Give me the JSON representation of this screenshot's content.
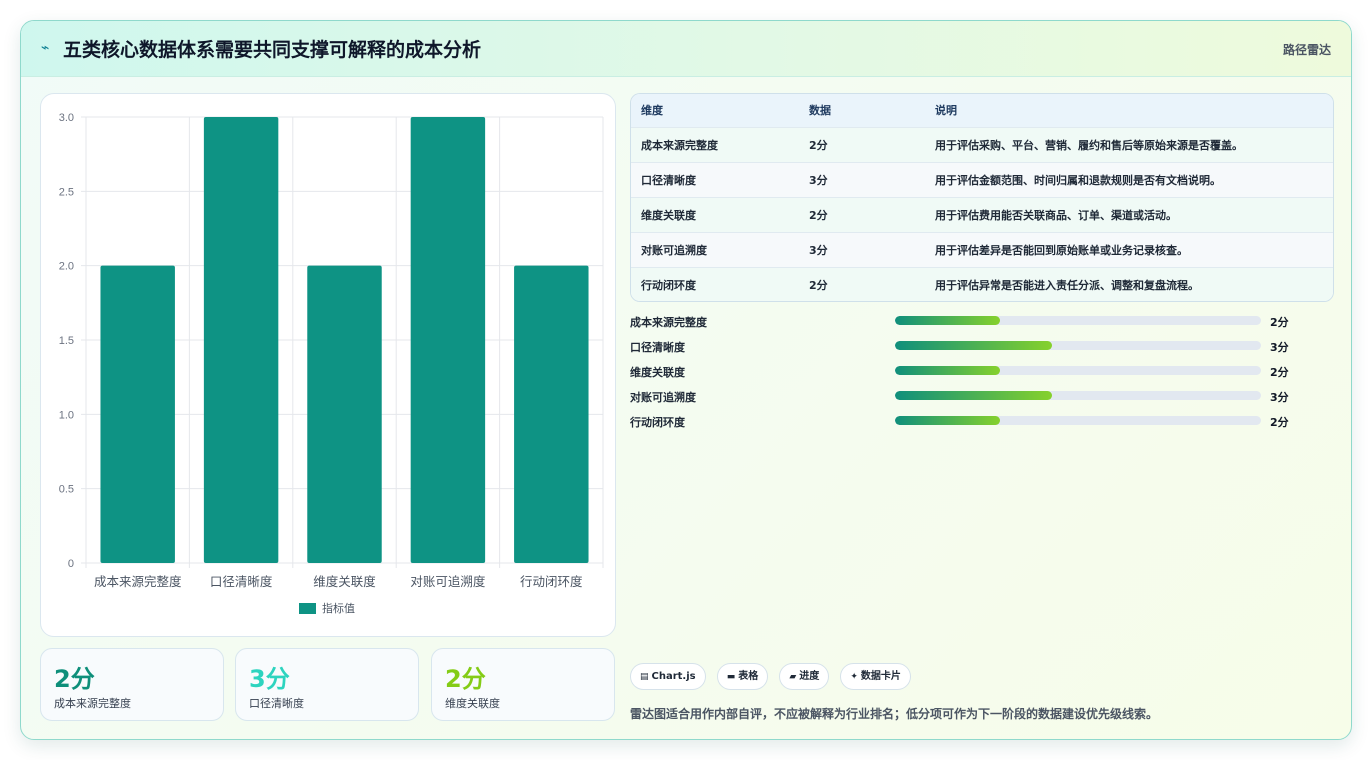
{
  "header": {
    "icon": "trend-icon",
    "title": "五类核心数据体系需要共同支撑可解释的成本分析",
    "right_label": "路径雷达"
  },
  "chart_data": {
    "type": "bar",
    "categories": [
      "成本来源完整度",
      "口径清晰度",
      "维度关联度",
      "对账可追溯度",
      "行动闭环度"
    ],
    "series": [
      {
        "name": "指标值",
        "values": [
          2,
          3,
          2,
          3,
          2
        ],
        "color": "#0e9384"
      }
    ],
    "ylim": [
      0,
      3
    ],
    "yticks": [
      "0",
      "0.5",
      "1.0",
      "1.5",
      "2.0",
      "2.5",
      "3.0"
    ],
    "legend": "bottom",
    "grid": true
  },
  "stats": [
    {
      "value": "2分",
      "label": "成本来源完整度",
      "color": "#0e8f7a"
    },
    {
      "value": "3分",
      "label": "口径清晰度",
      "color": "#2dd4bf"
    },
    {
      "value": "2分",
      "label": "维度关联度",
      "color": "#84cc16"
    }
  ],
  "table": {
    "headers": [
      "维度",
      "数据",
      "说明"
    ],
    "rows": [
      [
        "成本来源完整度",
        "2分",
        "用于评估采购、平台、营销、履约和售后等原始来源是否覆盖。"
      ],
      [
        "口径清晰度",
        "3分",
        "用于评估金额范围、时间归属和退款规则是否有文档说明。"
      ],
      [
        "维度关联度",
        "2分",
        "用于评估费用能否关联商品、订单、渠道或活动。"
      ],
      [
        "对账可追溯度",
        "3分",
        "用于评估差异是否能回到原始账单或业务记录核查。"
      ],
      [
        "行动闭环度",
        "2分",
        "用于评估异常是否能进入责任分派、调整和复盘流程。"
      ]
    ]
  },
  "progress": {
    "max": 7,
    "items": [
      {
        "label": "成本来源完整度",
        "value": 2,
        "text": "2分"
      },
      {
        "label": "口径清晰度",
        "value": 3,
        "text": "3分"
      },
      {
        "label": "维度关联度",
        "value": 2,
        "text": "2分"
      },
      {
        "label": "对账可追溯度",
        "value": 3,
        "text": "3分"
      },
      {
        "label": "行动闭环度",
        "value": 2,
        "text": "2分"
      }
    ]
  },
  "tags": [
    {
      "icon": "chart-icon",
      "glyph": "▤",
      "label": "Chart.js"
    },
    {
      "icon": "table-icon",
      "glyph": "▬",
      "label": "表格"
    },
    {
      "icon": "progress-icon",
      "glyph": "▰",
      "label": "进度"
    },
    {
      "icon": "sparkle-icon",
      "glyph": "✦",
      "label": "数据卡片"
    }
  ],
  "footnote": "雷达图适合用作内部自评，不应被解释为行业排名；低分项可作为下一阶段的数据建设优先级线索。"
}
